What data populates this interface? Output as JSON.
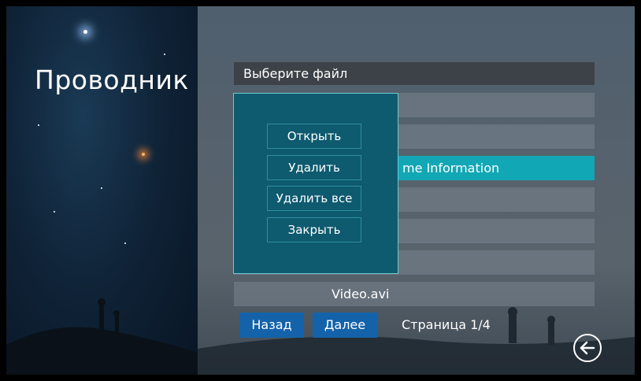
{
  "app": {
    "title": "Проводник"
  },
  "file_list": {
    "header": "Выберите файл",
    "rows": [
      {
        "label": ""
      },
      {
        "label": ""
      },
      {
        "label": "me Information",
        "selected": true
      },
      {
        "label": ""
      },
      {
        "label": ""
      },
      {
        "label": ""
      },
      {
        "label": "Video.avi"
      }
    ]
  },
  "context_menu": {
    "items": [
      "Открыть",
      "Удалить",
      "Удалить все",
      "Закрыть"
    ]
  },
  "pager": {
    "back_label": "Назад",
    "next_label": "Далее",
    "page_text": "Страница 1/4"
  },
  "icons": {
    "return": "return-arrow-icon"
  },
  "colors": {
    "accent": "#12a7b4",
    "nav_button": "#1462aa",
    "menu_bg": "#0e5a6f"
  }
}
